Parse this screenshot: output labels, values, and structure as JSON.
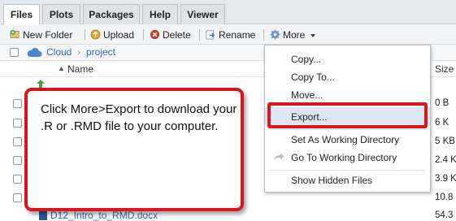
{
  "tabs": [
    {
      "label": "Files",
      "active": true
    },
    {
      "label": "Plots",
      "active": false
    },
    {
      "label": "Packages",
      "active": false
    },
    {
      "label": "Help",
      "active": false
    },
    {
      "label": "Viewer",
      "active": false
    }
  ],
  "toolbar": {
    "new_folder": "New Folder",
    "upload": "Upload",
    "delete": "Delete",
    "rename": "Rename",
    "more": "More",
    "icons": [
      "new-folder-icon",
      "upload-icon",
      "delete-icon",
      "rename-icon",
      "gear-icon",
      "caret-down-icon"
    ]
  },
  "breadcrumb": {
    "items": [
      "Cloud",
      "project"
    ]
  },
  "columns": {
    "name": "Name",
    "size": "Size"
  },
  "files": {
    "sizes": [
      "0 B",
      "6 K",
      "5 KB",
      "2.4 K",
      "3.9 K",
      "10.8",
      "54.3"
    ],
    "last_name_partial": "D12_Intro_to_RMD.docx"
  },
  "menu": {
    "items": [
      "Copy...",
      "Copy To...",
      "Move...",
      "Export...",
      "Set As Working Directory",
      "Go To Working Directory",
      "Show Hidden Files"
    ],
    "highlighted": "Export..."
  },
  "callout": {
    "text": "Click More>Export to download your .R or .RMD file to your computer."
  },
  "colors": {
    "highlight_red": "#d9161b",
    "menu_hover": "#dde6f3",
    "link_blue": "#3a66a8"
  }
}
